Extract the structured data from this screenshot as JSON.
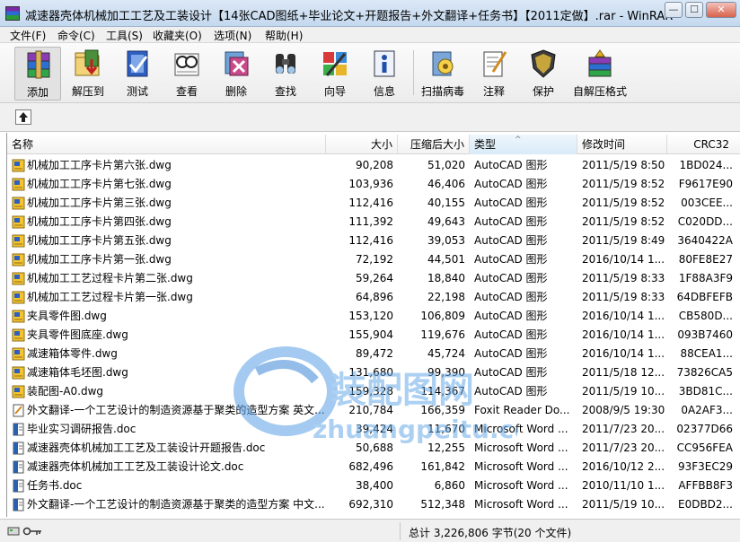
{
  "window": {
    "title": "减速器壳体机械加工工艺及工装设计【14张CAD图纸+毕业论文+开题报告+外文翻译+任务书】【2011定做】.rar - WinRAR",
    "min_label": "—",
    "max_label": "☐",
    "close_label": "✕"
  },
  "menu": [
    "文件(F)",
    "命令(C)",
    "工具(S)",
    "收藏夹(O)",
    "选项(N)",
    "帮助(H)"
  ],
  "toolbar": [
    {
      "label": "添加",
      "icon": "add-archive-icon"
    },
    {
      "label": "解压到",
      "icon": "extract-to-icon"
    },
    {
      "label": "测试",
      "icon": "test-icon"
    },
    {
      "label": "查看",
      "icon": "view-icon"
    },
    {
      "label": "删除",
      "icon": "delete-icon"
    },
    {
      "label": "查找",
      "icon": "find-icon"
    },
    {
      "label": "向导",
      "icon": "wizard-icon"
    },
    {
      "label": "信息",
      "icon": "info-icon"
    },
    {
      "label": "扫描病毒",
      "icon": "virus-scan-icon"
    },
    {
      "label": "注释",
      "icon": "comment-icon"
    },
    {
      "label": "保护",
      "icon": "protect-icon"
    },
    {
      "label": "自解压格式",
      "icon": "sfx-icon"
    }
  ],
  "columns": {
    "name": "名称",
    "size": "大小",
    "packed": "压缩后大小",
    "type": "类型",
    "modified": "修改时间",
    "crc": "CRC32"
  },
  "files": [
    {
      "name": "机械加工工序卡片第六张.dwg",
      "size": "90,208",
      "packed": "51,020",
      "type": "AutoCAD 图形",
      "modified": "2011/5/19 8:50",
      "crc": "1BD024...",
      "icon": "dwg"
    },
    {
      "name": "机械加工工序卡片第七张.dwg",
      "size": "103,936",
      "packed": "46,406",
      "type": "AutoCAD 图形",
      "modified": "2011/5/19 8:52",
      "crc": "F9617E90",
      "icon": "dwg"
    },
    {
      "name": "机械加工工序卡片第三张.dwg",
      "size": "112,416",
      "packed": "40,155",
      "type": "AutoCAD 图形",
      "modified": "2011/5/19 8:52",
      "crc": "003CEE...",
      "icon": "dwg"
    },
    {
      "name": "机械加工工序卡片第四张.dwg",
      "size": "111,392",
      "packed": "49,643",
      "type": "AutoCAD 图形",
      "modified": "2011/5/19 8:52",
      "crc": "C020DD...",
      "icon": "dwg"
    },
    {
      "name": "机械加工工序卡片第五张.dwg",
      "size": "112,416",
      "packed": "39,053",
      "type": "AutoCAD 图形",
      "modified": "2011/5/19 8:49",
      "crc": "3640422A",
      "icon": "dwg"
    },
    {
      "name": "机械加工工序卡片第一张.dwg",
      "size": "72,192",
      "packed": "44,501",
      "type": "AutoCAD 图形",
      "modified": "2016/10/14 1...",
      "crc": "80FE8E27",
      "icon": "dwg"
    },
    {
      "name": "机械加工工艺过程卡片第二张.dwg",
      "size": "59,264",
      "packed": "18,840",
      "type": "AutoCAD 图形",
      "modified": "2011/5/19 8:33",
      "crc": "1F88A3F9",
      "icon": "dwg"
    },
    {
      "name": "机械加工工艺过程卡片第一张.dwg",
      "size": "64,896",
      "packed": "22,198",
      "type": "AutoCAD 图形",
      "modified": "2011/5/19 8:33",
      "crc": "64DBFEFB",
      "icon": "dwg"
    },
    {
      "name": "夹具零件图.dwg",
      "size": "153,120",
      "packed": "106,809",
      "type": "AutoCAD 图形",
      "modified": "2016/10/14 1...",
      "crc": "CB580D...",
      "icon": "dwg"
    },
    {
      "name": "夹具零件图底座.dwg",
      "size": "155,904",
      "packed": "119,676",
      "type": "AutoCAD 图形",
      "modified": "2016/10/14 1...",
      "crc": "093B7460",
      "icon": "dwg"
    },
    {
      "name": "减速箱体零件.dwg",
      "size": "89,472",
      "packed": "45,724",
      "type": "AutoCAD 图形",
      "modified": "2016/10/14 1...",
      "crc": "88CEA1...",
      "icon": "dwg"
    },
    {
      "name": "减速箱体毛坯图.dwg",
      "size": "131,680",
      "packed": "99,390",
      "type": "AutoCAD 图形",
      "modified": "2011/5/18 12...",
      "crc": "73826CA5",
      "icon": "dwg"
    },
    {
      "name": "装配图-A0.dwg",
      "size": "159,328",
      "packed": "114,367",
      "type": "AutoCAD 图形",
      "modified": "2011/5/19 10...",
      "crc": "3BD81C...",
      "icon": "dwg"
    },
    {
      "name": "外文翻译-一个工艺设计的制造资源基于聚类的造型方案 英文...",
      "size": "210,784",
      "packed": "166,359",
      "type": "Foxit Reader Do...",
      "modified": "2008/9/5 19:30",
      "crc": "0A2AF3...",
      "icon": "pdf"
    },
    {
      "name": "毕业实习调研报告.doc",
      "size": "39,424",
      "packed": "11,670",
      "type": "Microsoft Word ...",
      "modified": "2011/7/23 20...",
      "crc": "02377D66",
      "icon": "doc"
    },
    {
      "name": "减速器壳体机械加工工艺及工装设计开题报告.doc",
      "size": "50,688",
      "packed": "12,255",
      "type": "Microsoft Word ...",
      "modified": "2011/7/23 20...",
      "crc": "CC956FEA",
      "icon": "doc"
    },
    {
      "name": "减速器壳体机械加工工艺及工装设计论文.doc",
      "size": "682,496",
      "packed": "161,842",
      "type": "Microsoft Word ...",
      "modified": "2016/10/12 2...",
      "crc": "93F3EC29",
      "icon": "doc"
    },
    {
      "name": "任务书.doc",
      "size": "38,400",
      "packed": "6,860",
      "type": "Microsoft Word ...",
      "modified": "2010/11/10 1...",
      "crc": "AFFBB8F3",
      "icon": "doc"
    },
    {
      "name": "外文翻译-一个工艺设计的制造资源基于聚类的造型方案 中文...",
      "size": "692,310",
      "packed": "512,348",
      "type": "Microsoft Word ...",
      "modified": "2011/5/19 10...",
      "crc": "E0DBD2...",
      "icon": "doc"
    }
  ],
  "status": {
    "text": "总计 3,226,806 字节(20 个文件)"
  },
  "watermark": {
    "cn": "装配图网",
    "en": "zhuangpeitu.com"
  }
}
